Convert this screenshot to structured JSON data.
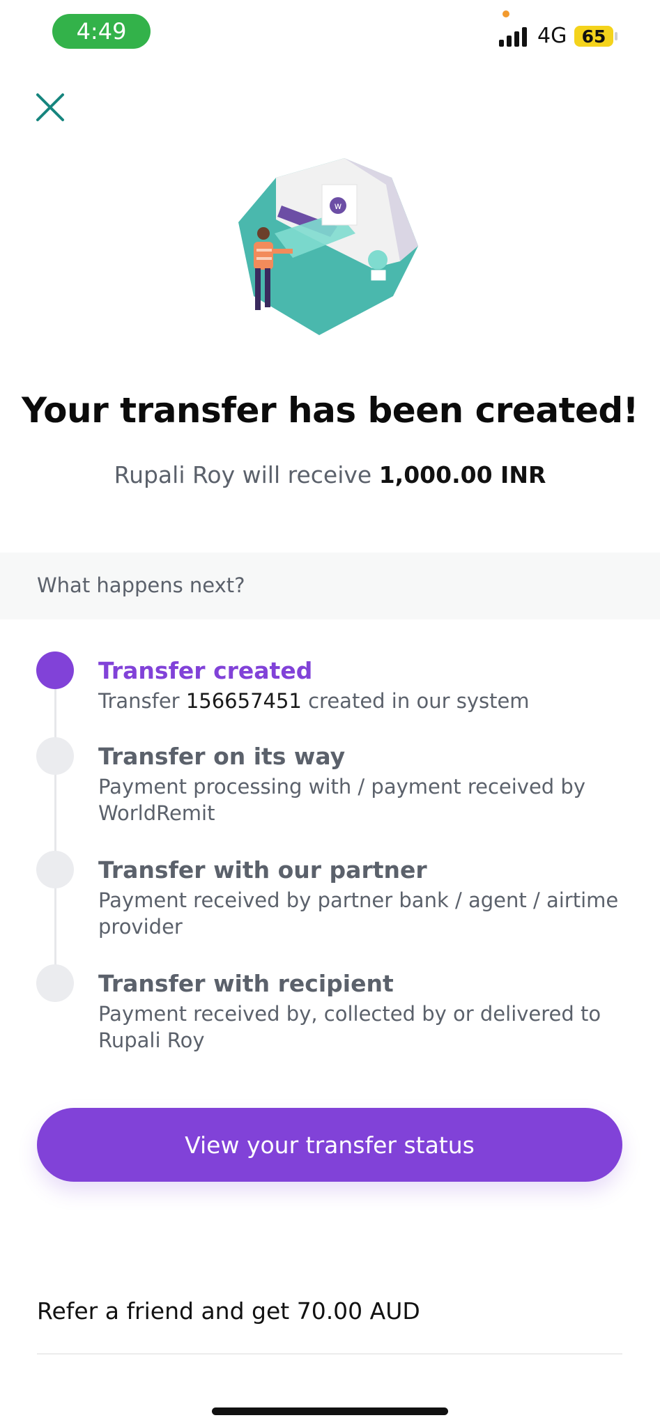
{
  "status_bar": {
    "time": "4:49",
    "network": "4G",
    "battery": "65"
  },
  "header": {
    "close_icon": "close-icon"
  },
  "hero": {
    "illustration": "transfer-illustration",
    "title": "Your transfer has been created!",
    "subtitle_prefix": "Rupali Roy will receive ",
    "amount": "1,000.00 INR"
  },
  "next": {
    "heading": "What happens next?",
    "steps": [
      {
        "title": "Transfer created",
        "desc_prefix": "Transfer ",
        "desc_id": "156657451",
        "desc_suffix": " created in our system",
        "active": true
      },
      {
        "title": "Transfer on its way",
        "desc": "Payment processing with / payment received by WorldRemit",
        "active": false
      },
      {
        "title": "Transfer with our partner",
        "desc": "Payment received by partner bank / agent / airtime provider",
        "active": false
      },
      {
        "title": "Transfer with recipient",
        "desc": "Payment received by, collected by or delivered to Rupali Roy",
        "active": false
      }
    ]
  },
  "cta": {
    "label": "View your transfer status"
  },
  "referral": {
    "label": "Refer a friend and get 70.00 AUD"
  },
  "colors": {
    "accent": "#8142d8",
    "teal": "#4ab8ad",
    "status_green": "#33b24a"
  }
}
